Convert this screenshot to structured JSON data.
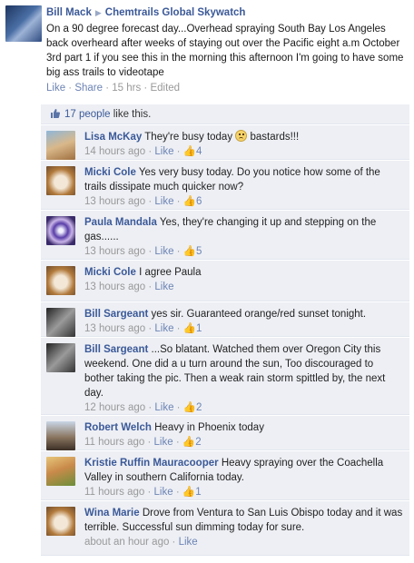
{
  "post": {
    "author": "Bill Mack",
    "arrow": "▶",
    "group": "Chemtrails Global Skywatch",
    "text": "On a 90 degree forecast day...Overhead spraying South Bay Los Angeles back overheard after weeks of staying out over the Pacific eight a.m October 3rd part 1 if you see this in the morning this afternoon I'm going to have some big ass trails to videotape",
    "like_label": "Like",
    "share_label": "Share",
    "time": "15 hrs",
    "edited": "Edited",
    "sep": " · "
  },
  "likes": {
    "count_text": "17 people",
    "suffix": " like this."
  },
  "comments": [
    {
      "name": "Lisa McKay",
      "text": "They're busy today",
      "after_emoji": " bastards!!!",
      "emoji": "frown",
      "time": "14 hours ago",
      "like": "Like",
      "likes": "4"
    },
    {
      "name": "Micki Cole",
      "text": "Yes very busy today. Do you notice how some of the trails dissipate much quicker now?",
      "time": "13 hours ago",
      "like": "Like",
      "likes": "6"
    },
    {
      "name": "Paula Mandala",
      "text": "Yes, they're changing it up and stepping on the gas......",
      "time": "13 hours ago",
      "like": "Like",
      "likes": "5"
    },
    {
      "name": "Micki Cole",
      "text": "I agree Paula",
      "time": "13 hours ago",
      "like": "Like",
      "likes": ""
    },
    {
      "name": "Bill Sargeant",
      "text": "yes sir. Guaranteed orange/red sunset tonight.",
      "time": "13 hours ago",
      "like": "Like",
      "likes": "1"
    },
    {
      "name": "Bill Sargeant",
      "text": "...So blatant. Watched them over Oregon City this weekend. One did a u turn around the sun, Too discouraged to bother taking the pic. Then a weak rain storm spittled by, the next day.",
      "time": "12 hours ago",
      "like": "Like",
      "likes": "2"
    },
    {
      "name": "Robert Welch",
      "text": "Heavy in Phoenix today",
      "time": "11 hours ago",
      "like": "Like",
      "likes": "2"
    },
    {
      "name": "Kristie Ruffin Mauracooper",
      "text": "Heavy spraying over the Coachella Valley in southern California today.",
      "time": "11 hours ago",
      "like": "Like",
      "likes": "1"
    },
    {
      "name": "Wina Marie",
      "text": "Drove from Ventura to San Luis Obispo today and it was terrible. Successful sun dimming today for sure.",
      "time": "about an hour ago",
      "like": "Like",
      "likes": ""
    }
  ],
  "colors": {
    "link_blue": "#3b5998",
    "comment_bg": "#edeff4",
    "meta_grey": "#999999"
  }
}
